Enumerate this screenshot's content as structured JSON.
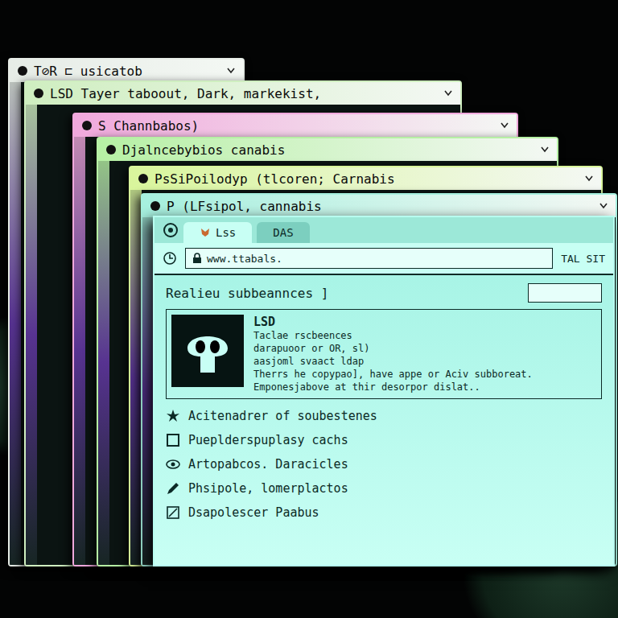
{
  "windows": [
    {
      "title": "T⊘R ⊏ usicatob",
      "color": "#e6ece6"
    },
    {
      "title": "LSD Tayer taboout, Dark, markekist,",
      "color": "#cfeec0"
    },
    {
      "title": "S Channbabos)",
      "color": "#f0a8dc"
    },
    {
      "title": "Djalncebybios canabis",
      "color": "#b6f0a4"
    },
    {
      "title": "PsSiPoilodyp (tlcoren; Carnabis",
      "color": "#d9f59c"
    },
    {
      "title": "P (LFsipol, cannabis",
      "color": "#a6f0df"
    }
  ],
  "front_window": {
    "tabs": [
      {
        "label": "Lss",
        "selected": true
      },
      {
        "label": "DAS",
        "selected": false
      }
    ],
    "address": "www.ttabals.",
    "site_label": "TAL SIT",
    "heading": "Realieu subbeannces ]",
    "card": {
      "title": "LSD",
      "lines": [
        "Taclae rscbeences",
        "darapuoor or OR, sl)",
        "aasjoml svaact ldap",
        "Therrs he copypao], have appe or Aciv subboreat.",
        "Emponesjabove at thir desorpor dislat.."
      ]
    },
    "list": [
      {
        "label": "Acitenadrer of soubestenes"
      },
      {
        "label": "Pueplderspuplasy cachs"
      },
      {
        "label": "Artopabcos. Daracicles"
      },
      {
        "label": "Phsipole, lomerplactos"
      },
      {
        "label": "Dsapolescer Paabus"
      }
    ]
  }
}
